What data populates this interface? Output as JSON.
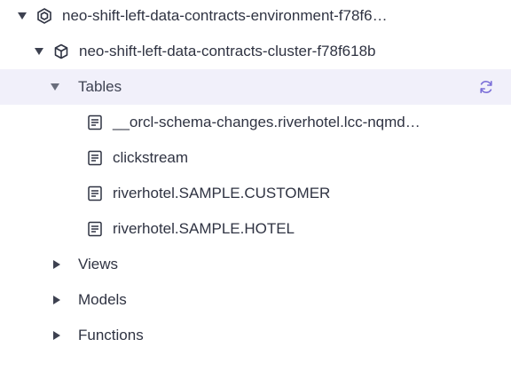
{
  "tree": {
    "environment": {
      "label": "neo-shift-left-data-contracts-environment-f78f6…",
      "icon": "environment-icon"
    },
    "cluster": {
      "label": "neo-shift-left-data-contracts-cluster-f78f618b",
      "icon": "cluster-cube-icon"
    },
    "tables": {
      "label": "Tables",
      "refresh_icon": "refresh-icon",
      "items": [
        {
          "label": "__orcl-schema-changes.riverhotel.lcc-nqmd…",
          "icon": "table-doc-icon"
        },
        {
          "label": "clickstream",
          "icon": "table-doc-icon"
        },
        {
          "label": "riverhotel.SAMPLE.CUSTOMER",
          "icon": "table-doc-icon"
        },
        {
          "label": "riverhotel.SAMPLE.HOTEL",
          "icon": "table-doc-icon"
        }
      ]
    },
    "views": {
      "label": "Views"
    },
    "models": {
      "label": "Models"
    },
    "functions": {
      "label": "Functions"
    }
  },
  "colors": {
    "selected_row_bg": "#f1f0fa",
    "accent": "#7b6fd8",
    "text": "#2f3342"
  }
}
